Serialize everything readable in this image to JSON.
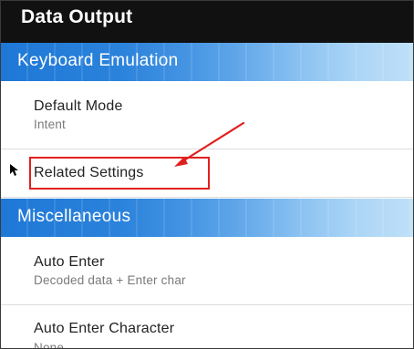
{
  "app_bar": {
    "title": "Data Output"
  },
  "sections": [
    {
      "header": "Keyboard Emulation",
      "items": [
        {
          "title": "Default Mode",
          "summary": "Intent"
        },
        {
          "title": "Related Settings",
          "summary": ""
        }
      ]
    },
    {
      "header": "Miscellaneous",
      "items": [
        {
          "title": "Auto Enter",
          "summary": "Decoded data + Enter char"
        },
        {
          "title": "Auto Enter Character",
          "summary": "None"
        }
      ]
    }
  ],
  "annotation": {
    "color": "#e0201f"
  },
  "colors": {
    "app_bar": "#111111",
    "section_blue": "#1f78d6"
  }
}
